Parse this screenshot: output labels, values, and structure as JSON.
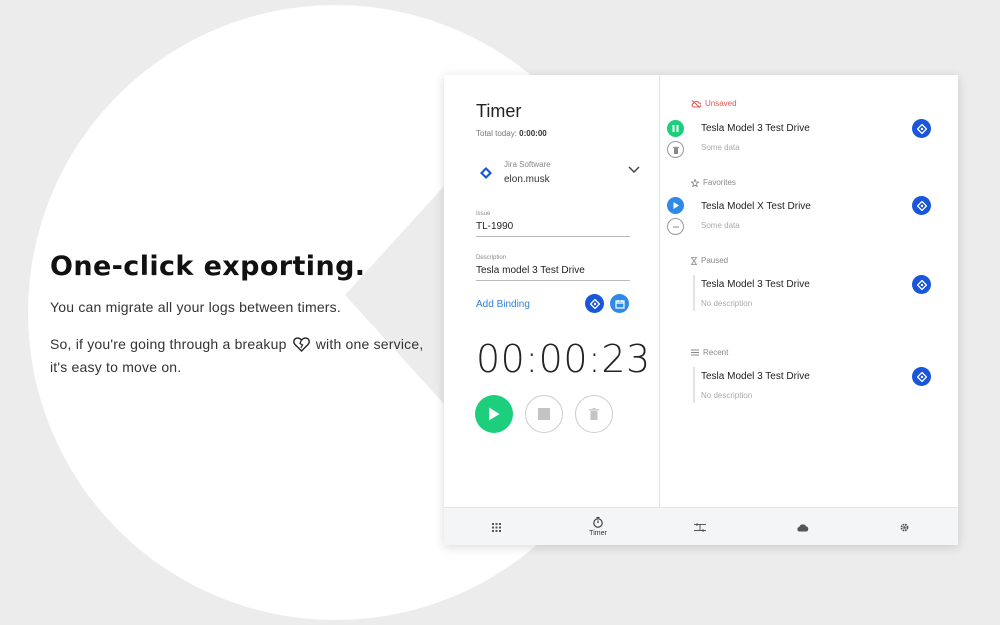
{
  "promo": {
    "heading": "One-click exporting.",
    "line1": "You can migrate all your logs between timers.",
    "line2_a": "So, if you're going through a breakup",
    "line2_b": "with one service, it's easy to move on."
  },
  "timer": {
    "title": "Timer",
    "total_label": "Total today:",
    "total_value": "0:00:00",
    "service_name": "Jira Software",
    "service_user": "elon.musk",
    "issue_label": "Issue",
    "issue_value": "TL-1990",
    "desc_label": "Description",
    "desc_value": "Tesla model 3 Test Drive",
    "add_binding": "Add Binding",
    "clock": "00:00:23"
  },
  "sections": {
    "unsaved": "Unsaved",
    "favorites": "Favorites",
    "paused": "Paused",
    "recent": "Recent"
  },
  "entries": [
    {
      "title": "Tesla Model 3 Test Drive",
      "sub": "Some data"
    },
    {
      "title": "Tesla Model X Test Drive",
      "sub": "Some data"
    },
    {
      "title": "Tesla Model 3 Test Drive",
      "sub": "No description"
    },
    {
      "title": "Tesla Model 3 Test Drive",
      "sub": "No description"
    }
  ],
  "nav": {
    "timer_label": "Timer"
  },
  "colors": {
    "accent_green": "#1dce7c",
    "accent_blue": "#1a56db",
    "unsaved_red": "#e05656"
  }
}
